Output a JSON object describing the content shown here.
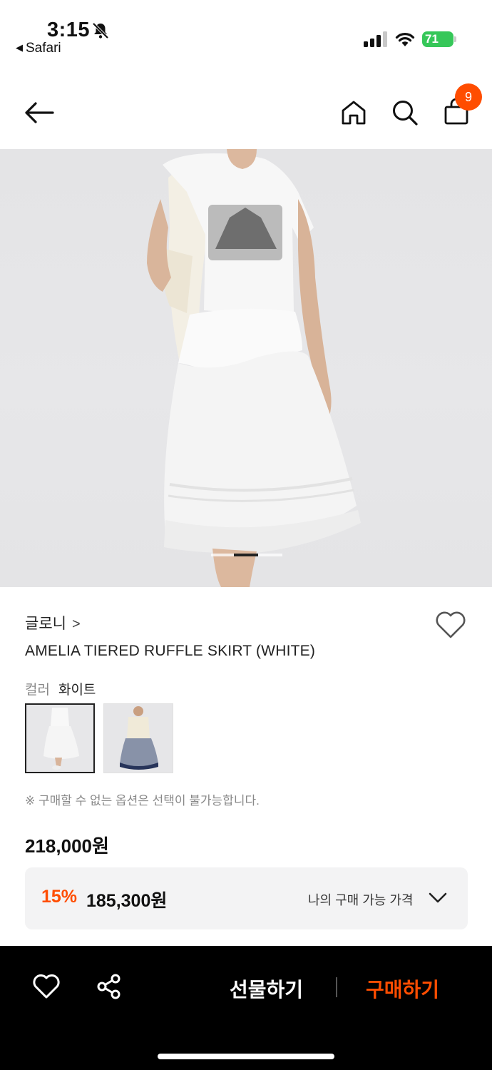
{
  "status_bar": {
    "time": "3:15",
    "back_app": "Safari",
    "battery": "71"
  },
  "nav": {
    "cart_count": "9"
  },
  "product": {
    "brand": "글로니",
    "brand_chevron": ">",
    "title": "AMELIA TIERED RUFFLE SKIRT (WHITE)",
    "color_label": "컬러",
    "color_value": "화이트",
    "notice": "※ 구매할 수 없는 옵션은 선택이 불가능합니다.",
    "price": "218,000원",
    "discount_pct": "15%",
    "discount_price": "185,300원",
    "my_price_label": "나의 구매 가능 가격"
  },
  "bottom_bar": {
    "gift_label": "선물하기",
    "buy_label": "구매하기"
  },
  "colors": {
    "accent": "#ff4d00",
    "battery": "#36c759"
  }
}
